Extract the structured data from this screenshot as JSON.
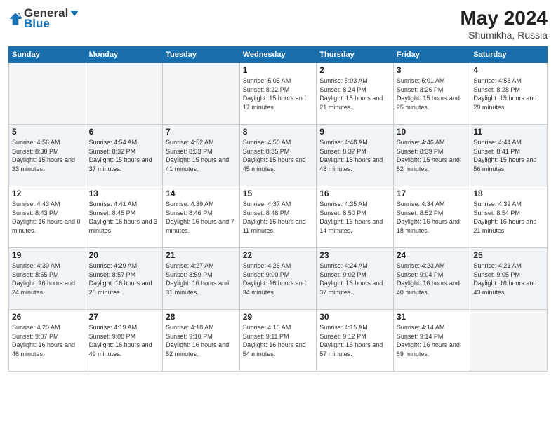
{
  "header": {
    "logo_general": "General",
    "logo_blue": "Blue",
    "month_year": "May 2024",
    "location": "Shumikha, Russia"
  },
  "weekdays": [
    "Sunday",
    "Monday",
    "Tuesday",
    "Wednesday",
    "Thursday",
    "Friday",
    "Saturday"
  ],
  "weeks": [
    [
      {
        "day": "",
        "sunrise": "",
        "sunset": "",
        "daylight": "",
        "empty": true
      },
      {
        "day": "",
        "sunrise": "",
        "sunset": "",
        "daylight": "",
        "empty": true
      },
      {
        "day": "",
        "sunrise": "",
        "sunset": "",
        "daylight": "",
        "empty": true
      },
      {
        "day": "1",
        "sunrise": "Sunrise: 5:05 AM",
        "sunset": "Sunset: 8:22 PM",
        "daylight": "Daylight: 15 hours and 17 minutes."
      },
      {
        "day": "2",
        "sunrise": "Sunrise: 5:03 AM",
        "sunset": "Sunset: 8:24 PM",
        "daylight": "Daylight: 15 hours and 21 minutes."
      },
      {
        "day": "3",
        "sunrise": "Sunrise: 5:01 AM",
        "sunset": "Sunset: 8:26 PM",
        "daylight": "Daylight: 15 hours and 25 minutes."
      },
      {
        "day": "4",
        "sunrise": "Sunrise: 4:58 AM",
        "sunset": "Sunset: 8:28 PM",
        "daylight": "Daylight: 15 hours and 29 minutes."
      }
    ],
    [
      {
        "day": "5",
        "sunrise": "Sunrise: 4:56 AM",
        "sunset": "Sunset: 8:30 PM",
        "daylight": "Daylight: 15 hours and 33 minutes."
      },
      {
        "day": "6",
        "sunrise": "Sunrise: 4:54 AM",
        "sunset": "Sunset: 8:32 PM",
        "daylight": "Daylight: 15 hours and 37 minutes."
      },
      {
        "day": "7",
        "sunrise": "Sunrise: 4:52 AM",
        "sunset": "Sunset: 8:33 PM",
        "daylight": "Daylight: 15 hours and 41 minutes."
      },
      {
        "day": "8",
        "sunrise": "Sunrise: 4:50 AM",
        "sunset": "Sunset: 8:35 PM",
        "daylight": "Daylight: 15 hours and 45 minutes."
      },
      {
        "day": "9",
        "sunrise": "Sunrise: 4:48 AM",
        "sunset": "Sunset: 8:37 PM",
        "daylight": "Daylight: 15 hours and 48 minutes."
      },
      {
        "day": "10",
        "sunrise": "Sunrise: 4:46 AM",
        "sunset": "Sunset: 8:39 PM",
        "daylight": "Daylight: 15 hours and 52 minutes."
      },
      {
        "day": "11",
        "sunrise": "Sunrise: 4:44 AM",
        "sunset": "Sunset: 8:41 PM",
        "daylight": "Daylight: 15 hours and 56 minutes."
      }
    ],
    [
      {
        "day": "12",
        "sunrise": "Sunrise: 4:43 AM",
        "sunset": "Sunset: 8:43 PM",
        "daylight": "Daylight: 16 hours and 0 minutes."
      },
      {
        "day": "13",
        "sunrise": "Sunrise: 4:41 AM",
        "sunset": "Sunset: 8:45 PM",
        "daylight": "Daylight: 16 hours and 3 minutes."
      },
      {
        "day": "14",
        "sunrise": "Sunrise: 4:39 AM",
        "sunset": "Sunset: 8:46 PM",
        "daylight": "Daylight: 16 hours and 7 minutes."
      },
      {
        "day": "15",
        "sunrise": "Sunrise: 4:37 AM",
        "sunset": "Sunset: 8:48 PM",
        "daylight": "Daylight: 16 hours and 11 minutes."
      },
      {
        "day": "16",
        "sunrise": "Sunrise: 4:35 AM",
        "sunset": "Sunset: 8:50 PM",
        "daylight": "Daylight: 16 hours and 14 minutes."
      },
      {
        "day": "17",
        "sunrise": "Sunrise: 4:34 AM",
        "sunset": "Sunset: 8:52 PM",
        "daylight": "Daylight: 16 hours and 18 minutes."
      },
      {
        "day": "18",
        "sunrise": "Sunrise: 4:32 AM",
        "sunset": "Sunset: 8:54 PM",
        "daylight": "Daylight: 16 hours and 21 minutes."
      }
    ],
    [
      {
        "day": "19",
        "sunrise": "Sunrise: 4:30 AM",
        "sunset": "Sunset: 8:55 PM",
        "daylight": "Daylight: 16 hours and 24 minutes."
      },
      {
        "day": "20",
        "sunrise": "Sunrise: 4:29 AM",
        "sunset": "Sunset: 8:57 PM",
        "daylight": "Daylight: 16 hours and 28 minutes."
      },
      {
        "day": "21",
        "sunrise": "Sunrise: 4:27 AM",
        "sunset": "Sunset: 8:59 PM",
        "daylight": "Daylight: 16 hours and 31 minutes."
      },
      {
        "day": "22",
        "sunrise": "Sunrise: 4:26 AM",
        "sunset": "Sunset: 9:00 PM",
        "daylight": "Daylight: 16 hours and 34 minutes."
      },
      {
        "day": "23",
        "sunrise": "Sunrise: 4:24 AM",
        "sunset": "Sunset: 9:02 PM",
        "daylight": "Daylight: 16 hours and 37 minutes."
      },
      {
        "day": "24",
        "sunrise": "Sunrise: 4:23 AM",
        "sunset": "Sunset: 9:04 PM",
        "daylight": "Daylight: 16 hours and 40 minutes."
      },
      {
        "day": "25",
        "sunrise": "Sunrise: 4:21 AM",
        "sunset": "Sunset: 9:05 PM",
        "daylight": "Daylight: 16 hours and 43 minutes."
      }
    ],
    [
      {
        "day": "26",
        "sunrise": "Sunrise: 4:20 AM",
        "sunset": "Sunset: 9:07 PM",
        "daylight": "Daylight: 16 hours and 46 minutes."
      },
      {
        "day": "27",
        "sunrise": "Sunrise: 4:19 AM",
        "sunset": "Sunset: 9:08 PM",
        "daylight": "Daylight: 16 hours and 49 minutes."
      },
      {
        "day": "28",
        "sunrise": "Sunrise: 4:18 AM",
        "sunset": "Sunset: 9:10 PM",
        "daylight": "Daylight: 16 hours and 52 minutes."
      },
      {
        "day": "29",
        "sunrise": "Sunrise: 4:16 AM",
        "sunset": "Sunset: 9:11 PM",
        "daylight": "Daylight: 16 hours and 54 minutes."
      },
      {
        "day": "30",
        "sunrise": "Sunrise: 4:15 AM",
        "sunset": "Sunset: 9:12 PM",
        "daylight": "Daylight: 16 hours and 57 minutes."
      },
      {
        "day": "31",
        "sunrise": "Sunrise: 4:14 AM",
        "sunset": "Sunset: 9:14 PM",
        "daylight": "Daylight: 16 hours and 59 minutes."
      },
      {
        "day": "",
        "sunrise": "",
        "sunset": "",
        "daylight": "",
        "empty": true
      }
    ]
  ]
}
